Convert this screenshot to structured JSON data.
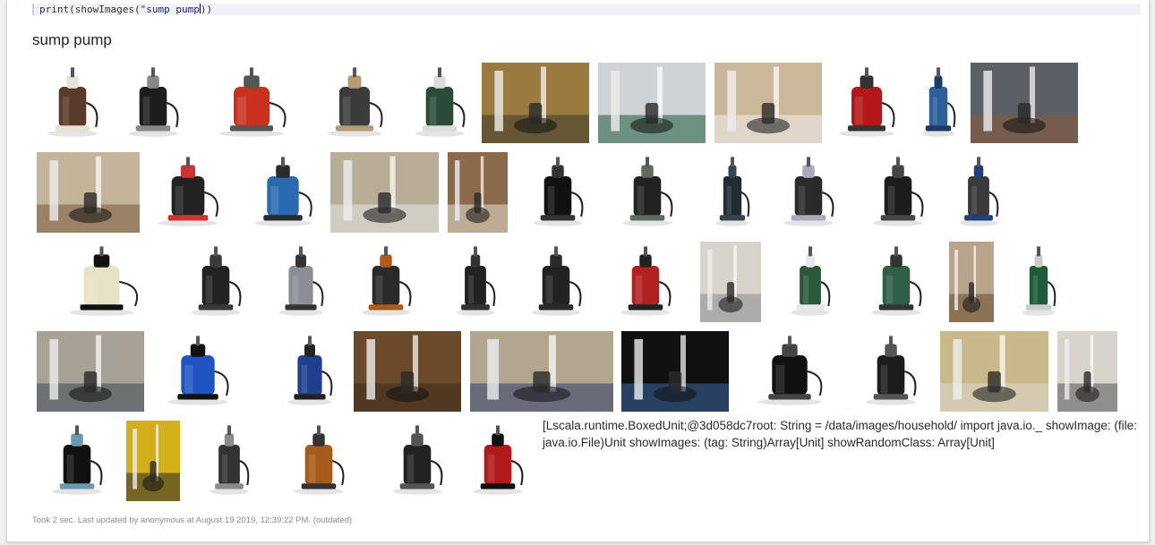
{
  "cell": {
    "code_fn": "print(showImages(",
    "code_str": "\"sump pump",
    "code_tail": "))"
  },
  "output": {
    "heading": "sump pump",
    "text": "[Lscala.runtime.BoxedUnit;@3d058dc7root: String = /data/images/household/ import java.io._ showImage: (file: java.io.File)Unit showImages: (tag: String)Array[Unit] showRandomClass: Array[Unit]"
  },
  "footer": {
    "status": "Took 2 sec. Last updated by anonymous at August 19 2019, 12:39:22 PM. (outdated)"
  },
  "image_count": 52
}
